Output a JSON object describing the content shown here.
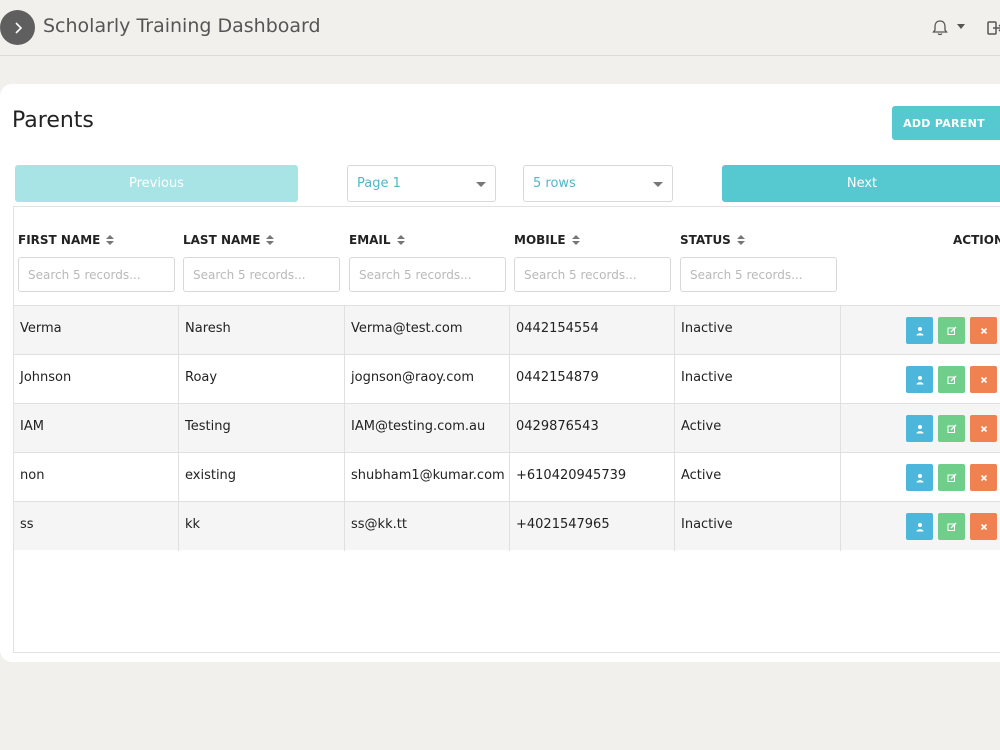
{
  "app": {
    "title": "Scholarly Training Dashboard"
  },
  "header": {
    "icons": [
      "chevron-right-icon",
      "bell-icon",
      "caret-down-icon",
      "logout-icon"
    ]
  },
  "page": {
    "title": "Parents",
    "add_button": "ADD PARENT"
  },
  "pagination": {
    "previous": "Previous",
    "next": "Next",
    "page_select": "Page 1",
    "rows_select": "5 rows"
  },
  "table": {
    "columns": [
      "FIRST NAME",
      "LAST NAME",
      "EMAIL",
      "MOBILE",
      "STATUS",
      "ACTION"
    ],
    "filter_placeholder": "Search 5 records...",
    "rows": [
      [
        "Verma",
        "Naresh",
        "Verma@test.com",
        "0442154554",
        "Inactive"
      ],
      [
        "Johnson",
        "Roay",
        "jognson@raoy.com",
        "0442154879",
        "Inactive"
      ],
      [
        "IAM",
        "Testing",
        "IAM@testing.com.au",
        "0429876543",
        "Active"
      ],
      [
        "non",
        "existing",
        "shubham1@kumar.com",
        "+610420945739",
        "Active"
      ],
      [
        "ss",
        "kk",
        "ss@kk.tt",
        "+4021547965",
        "Inactive"
      ]
    ]
  },
  "colors": {
    "accent": "#55c9cf",
    "accent_light": "#a8e4e6",
    "view": "#4cb6db",
    "edit": "#6fcf8a",
    "delete": "#ef8250"
  }
}
